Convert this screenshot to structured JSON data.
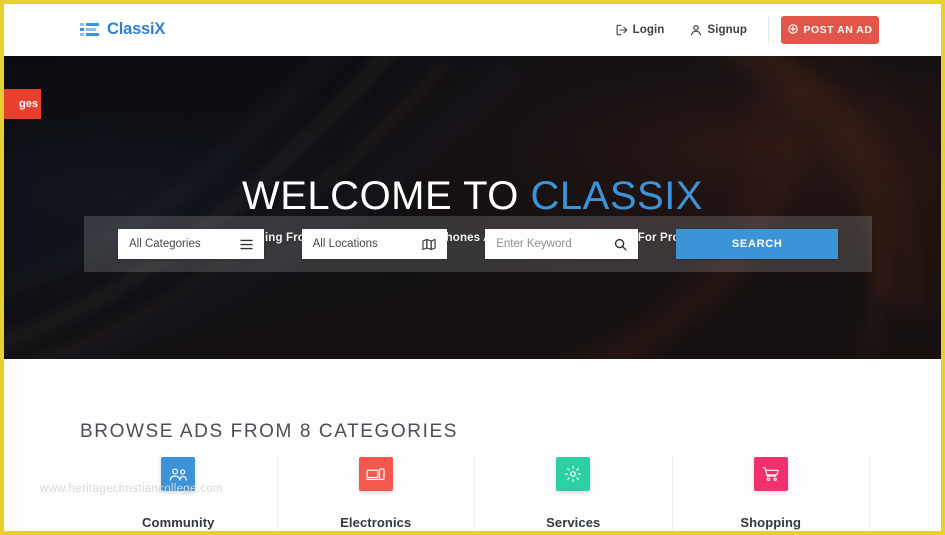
{
  "theme": {
    "page_border": "#e8d033",
    "brand_blue": "#2f7fd0",
    "accent_blue": "#3d93d8",
    "post_ad_red": "#e2564a",
    "side_tab_red": "#e8402c"
  },
  "header": {
    "logo_text": "ClassiX",
    "logo_icon": "list-icon",
    "login_label": "Login",
    "login_icon": "login-arrow-icon",
    "signup_label": "Signup",
    "signup_icon": "user-icon",
    "post_ad_label": "POST AN AD",
    "post_ad_icon": "plus-circle-icon"
  },
  "side_tab": {
    "label": "ges"
  },
  "hero": {
    "title_main": "WELCOME TO ",
    "title_accent": "CLASSIX",
    "subtitle": "Buy And Sell Everything From Used Cars To Mobile Phones And Computers, Or Search For Property, Jobs And More",
    "search": {
      "category_value": "All Categories",
      "category_icon": "hamburger-list-icon",
      "location_value": "All Locations",
      "location_icon": "map-icon",
      "keyword_placeholder": "Enter Keyword",
      "keyword_value": "",
      "keyword_icon": "search-icon",
      "button_label": "SEARCH"
    }
  },
  "categories_section": {
    "heading": "BROWSE ADS FROM 8 CATEGORIES",
    "watermark": "www.heritagechristiancollege.com",
    "items": [
      {
        "label": "Community",
        "icon": "people-icon",
        "color": "#3d93d8"
      },
      {
        "label": "Electronics",
        "icon": "devices-icon",
        "color": "#f4584f"
      },
      {
        "label": "Services",
        "icon": "gear-icon",
        "color": "#2bd1a5"
      },
      {
        "label": "Shopping",
        "icon": "cart-icon",
        "color": "#f2306c"
      }
    ]
  }
}
